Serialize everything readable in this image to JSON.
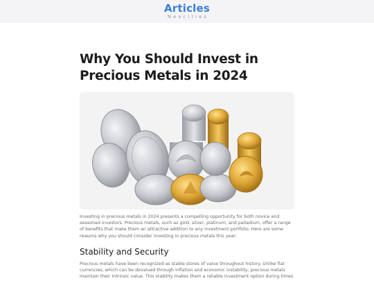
{
  "header": {
    "logo_main": "Articles",
    "logo_sub": "Neocities"
  },
  "article": {
    "title": "Why You Should Invest in Precious Metals in 2024",
    "hero_image": "precious-metal-coins-photo",
    "intro": "Investing in precious metals in 2024 presents a compelling opportunity for both novice and seasoned investors. Precious metals, such as gold, silver, platinum, and palladium, offer a range of benefits that make them an attractive addition to any investment portfolio. Here are some reasons why you should consider investing in precious metals this year:",
    "sections": [
      {
        "heading": "Stability and Security",
        "text": "Precious metals have been recognized as stable stores of value throughout history. Unlike fiat currencies, which can be devalued through inflation and economic instability, precious metals maintain their intrinsic value. This stability makes them a reliable investment option during times"
      }
    ]
  },
  "colors": {
    "logo_blue": "#3a7fd5",
    "topbar_bg": "#f4f4f6",
    "gold": "#d9a531",
    "silver": "#c9cbcf"
  }
}
